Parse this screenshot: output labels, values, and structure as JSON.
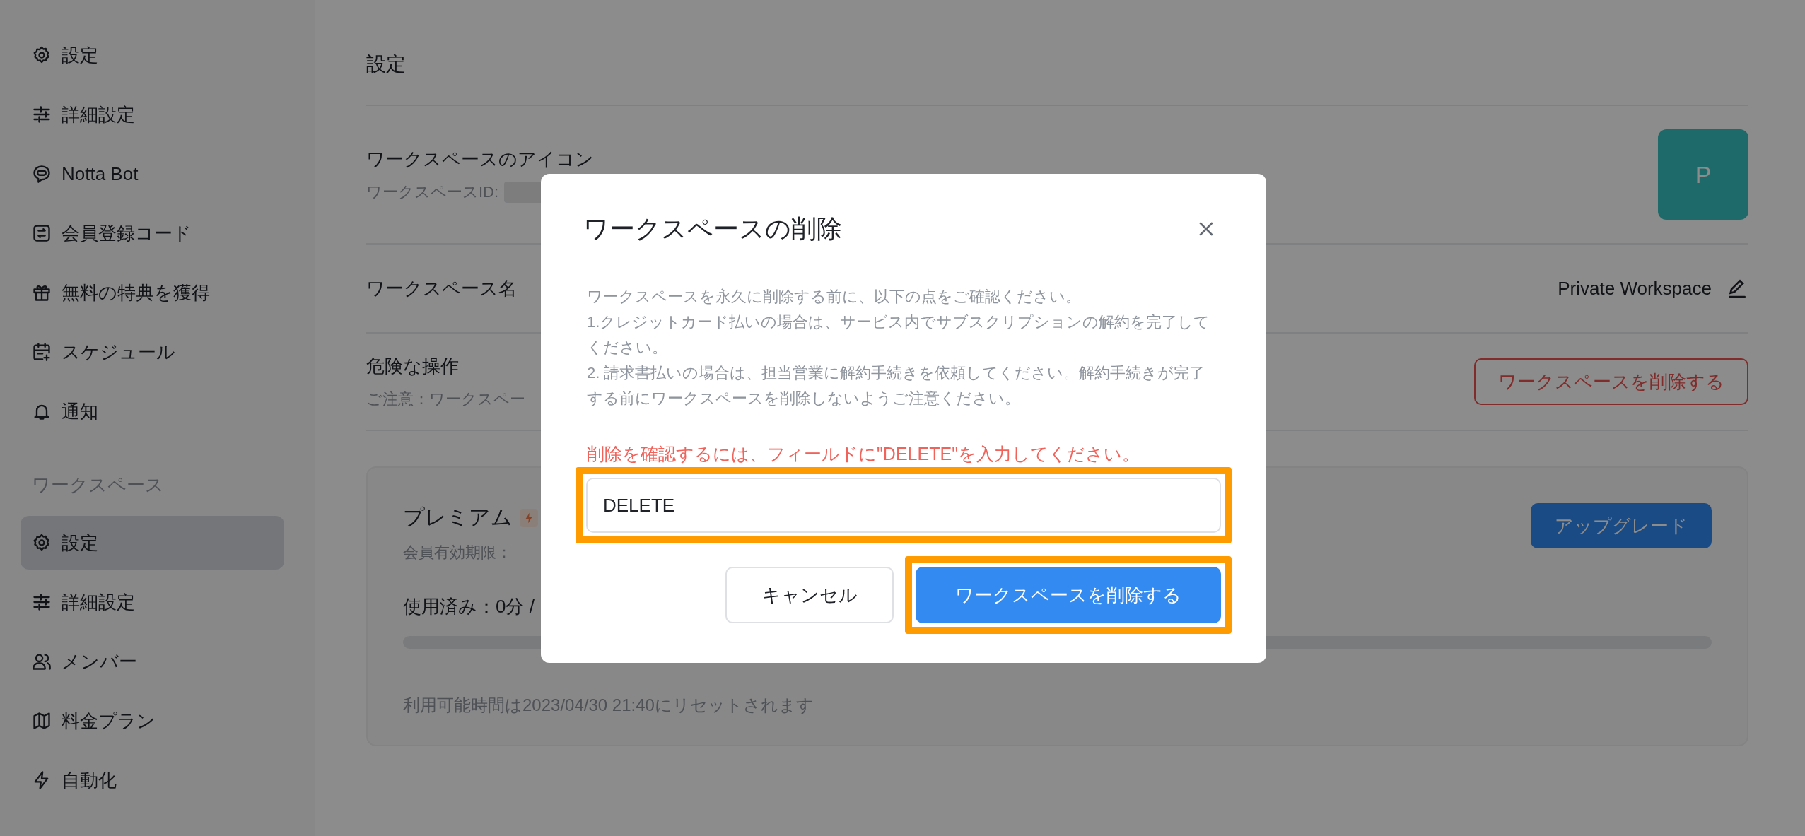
{
  "sidebar": {
    "personal_items": [
      {
        "label": "設定",
        "selected": false
      },
      {
        "label": "詳細設定",
        "selected": false
      },
      {
        "label": "Notta Bot",
        "selected": false
      },
      {
        "label": "会員登録コード",
        "selected": false
      },
      {
        "label": "無料の特典を獲得",
        "selected": false
      },
      {
        "label": "スケジュール",
        "selected": false
      },
      {
        "label": "通知",
        "selected": false
      }
    ],
    "workspace_heading": "ワークスペース",
    "workspace_items": [
      {
        "label": "設定",
        "selected": true
      },
      {
        "label": "詳細設定",
        "selected": false
      },
      {
        "label": "メンバー",
        "selected": false
      },
      {
        "label": "料金プラン",
        "selected": false
      },
      {
        "label": "自動化",
        "selected": false
      }
    ]
  },
  "main": {
    "title": "設定",
    "icon_row": {
      "label": "ワークスペースのアイコン",
      "sublabel": "ワークスペースID:",
      "avatar_letter": "P"
    },
    "name_row": {
      "label": "ワークスペース名",
      "value": "Private Workspace"
    },
    "danger_row": {
      "label": "危険な操作",
      "note": "ご注意：ワークスペー",
      "button": "ワークスペースを削除する"
    },
    "plan_card": {
      "name": "プレミアム",
      "expiry": "会員有効期限：",
      "usage": "使用済み：0分 /",
      "reset_note": "利用可能時間は2023/04/30 21:40にリセットされます",
      "upgrade_button": "アップグレード"
    }
  },
  "modal": {
    "title": "ワークスペースの削除",
    "paragraphs": [
      "ワークスペースを永久に削除する前に、以下の点をご確認ください。",
      "1.クレジットカード払いの場合は、サービス内でサブスクリプションの解約を完了してください。",
      "2. 請求書払いの場合は、担当営業に解約手続きを依頼してください。解約手続きが完了する前にワークスペースを削除しないようご注意ください。"
    ],
    "prompt": "削除を確認するには、フィールドに\"DELETE\"を入力してください。",
    "input_value": "DELETE",
    "cancel_button": "キャンセル",
    "confirm_button": "ワークスペースを削除する"
  }
}
